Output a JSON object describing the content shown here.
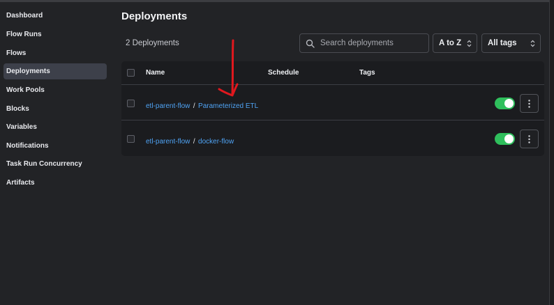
{
  "sidebar": {
    "items": [
      {
        "label": "Dashboard"
      },
      {
        "label": "Flow Runs"
      },
      {
        "label": "Flows"
      },
      {
        "label": "Deployments",
        "active": true
      },
      {
        "label": "Work Pools"
      },
      {
        "label": "Blocks"
      },
      {
        "label": "Variables"
      },
      {
        "label": "Notifications"
      },
      {
        "label": "Task Run Concurrency"
      },
      {
        "label": "Artifacts"
      }
    ]
  },
  "main": {
    "title": "Deployments",
    "count_text": "2 Deployments",
    "search": {
      "placeholder": "Search deployments",
      "value": ""
    },
    "sort": {
      "selected": "A to Z"
    },
    "tags_filter": {
      "selected": "All tags"
    },
    "table": {
      "columns": [
        "Name",
        "Schedule",
        "Tags"
      ],
      "rows": [
        {
          "flow": "etl-parent-flow",
          "separator": "/",
          "deployment": "Parameterized ETL",
          "schedule": "",
          "tags": "",
          "active": true
        },
        {
          "flow": "etl-parent-flow",
          "separator": "/",
          "deployment": "docker-flow",
          "schedule": "",
          "tags": "",
          "active": true
        }
      ]
    }
  },
  "colors": {
    "background": "#222326",
    "accent_link": "#4fa3f4",
    "toggle_on": "#2fbf5c",
    "annotation": "#e0181e"
  },
  "icons": {
    "search": "search-icon",
    "sort_chevron": "chevron-up-down-icon",
    "row_menu": "kebab-menu-icon"
  }
}
